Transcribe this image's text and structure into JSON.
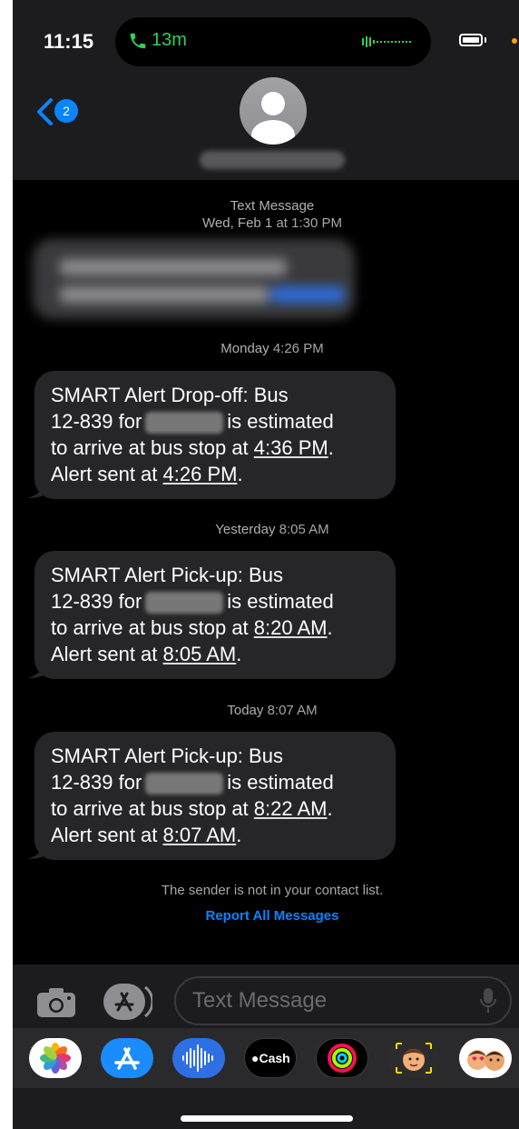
{
  "status": {
    "time": "11:15",
    "call_duration": "13m",
    "back_badge": "2"
  },
  "thread": {
    "header_type": "Text Message",
    "header_date": "Wed, Feb 1",
    "header_time": "at 1:30 PM",
    "messages": [
      {
        "timestamp_day": "Monday",
        "timestamp_time": "4:26 PM",
        "line1": "SMART Alert Drop-off: Bus",
        "line2_a": "12-839 for",
        "line2_b": "is estimated",
        "line3_a": "to arrive at bus stop at ",
        "line3_time": "4:36 PM",
        "line3_end": ".",
        "line4_a": "Alert sent at ",
        "line4_time": "4:26 PM",
        "line4_end": "."
      },
      {
        "timestamp_day": "Yesterday",
        "timestamp_time": "8:05 AM",
        "line1": "SMART Alert Pick-up: Bus",
        "line2_a": "12-839 for",
        "line2_b": "is estimated",
        "line3_a": "to arrive at bus stop at ",
        "line3_time": "8:20 AM",
        "line3_end": ".",
        "line4_a": "Alert sent at ",
        "line4_time": "8:05 AM",
        "line4_end": "."
      },
      {
        "timestamp_day": "Today",
        "timestamp_time": "8:07 AM",
        "line1": "SMART Alert Pick-up: Bus",
        "line2_a": "12-839 for",
        "line2_b": "is estimated",
        "line3_a": "to arrive at bus stop at ",
        "line3_time": "8:22 AM",
        "line3_end": ".",
        "line4_a": "Alert sent at ",
        "line4_time": "8:07 AM",
        "line4_end": "."
      }
    ],
    "sender_notice": "The sender is not in your contact list.",
    "report_link": "Report All Messages"
  },
  "composer": {
    "placeholder": "Text Message"
  },
  "dock": {
    "cash_label": "Cash"
  },
  "icons": [
    "phone-icon",
    "back-chevron-icon",
    "person-icon",
    "camera-icon",
    "app-store-icon",
    "microphone-icon"
  ],
  "colors": {
    "accent": "#0a84ff",
    "call_green": "#30d158",
    "bubble": "#262628",
    "background": "#000000"
  }
}
